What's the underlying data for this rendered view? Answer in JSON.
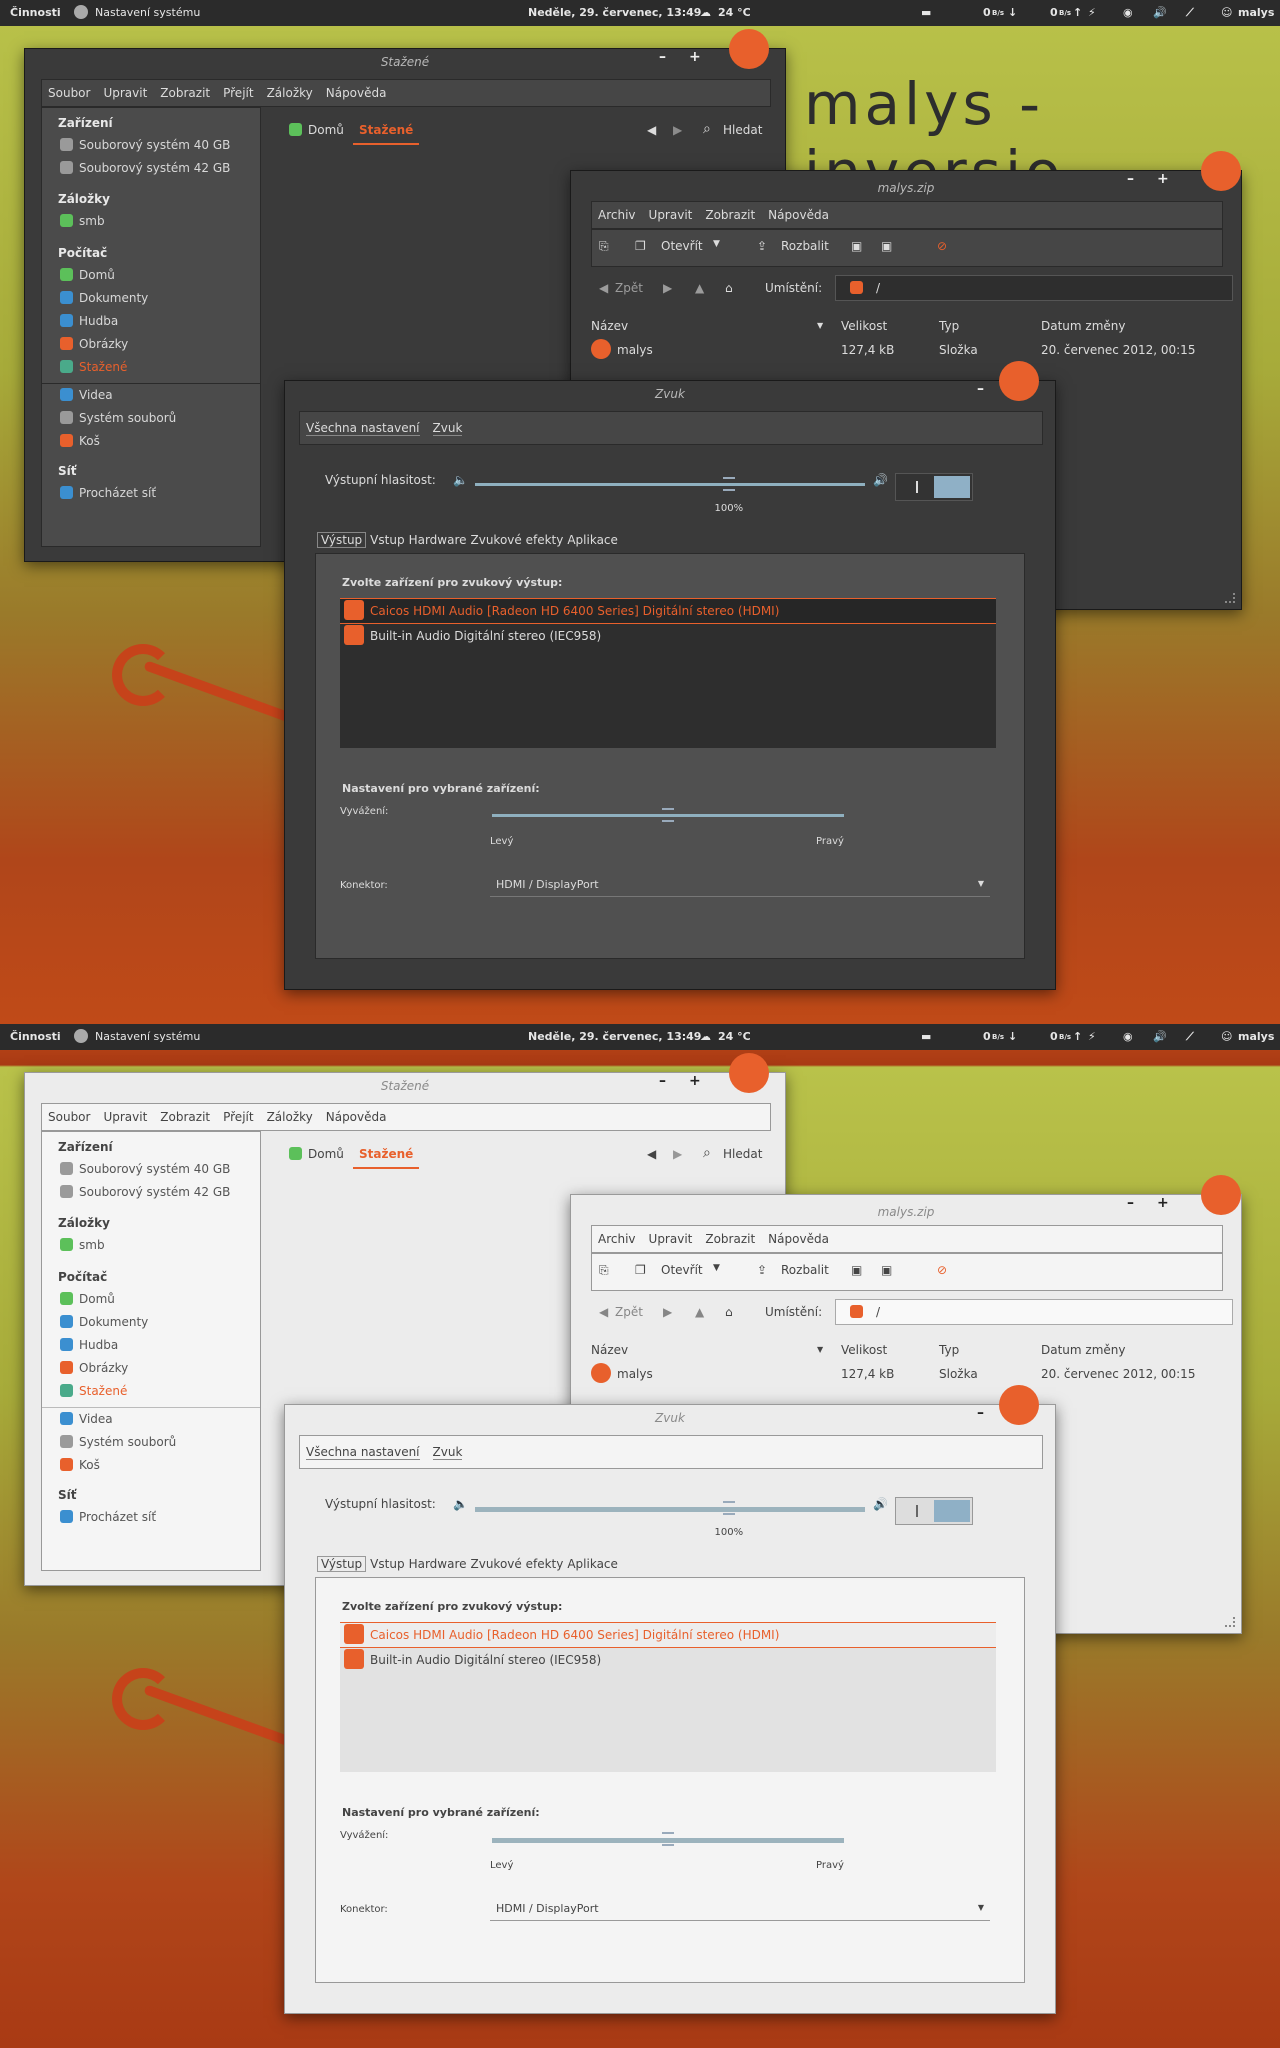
{
  "panel": {
    "activities": "Činnosti",
    "app": "Nastavení systému",
    "clock": "Neděle, 29. červenec, 13:49",
    "weather": "24 °C",
    "net_down": "0",
    "net_down_unit": "B/s",
    "net_up": "0",
    "net_up_unit": "B/s",
    "user": "malys"
  },
  "brand": "malys   -   inversio",
  "nautilus": {
    "title": "Stažené",
    "menu": [
      "Soubor",
      "Upravit",
      "Zobrazit",
      "Přejít",
      "Záložky",
      "Nápověda"
    ],
    "path": [
      "Domů",
      "Stažené"
    ],
    "search": "Hledat",
    "sections": {
      "devices": "Zařízení",
      "bookmarks": "Záložky",
      "computer": "Počítač",
      "network": "Síť"
    },
    "devices": [
      "Souborový systém 40 GB",
      "Souborový systém 42 GB"
    ],
    "bookmarks": [
      "smb"
    ],
    "computer": [
      "Domů",
      "Dokumenty",
      "Hudba",
      "Obrázky",
      "Stažené",
      "Videa",
      "Systém souborů",
      "Koš"
    ],
    "network": [
      "Procházet síť"
    ]
  },
  "archive": {
    "title": "malys.zip",
    "menu": [
      "Archiv",
      "Upravit",
      "Zobrazit",
      "Nápověda"
    ],
    "open": "Otevřít",
    "extract": "Rozbalit",
    "back": "Zpět",
    "location_label": "Umístění:",
    "location_value": "/",
    "columns": [
      "Název",
      "Velikost",
      "Typ",
      "Datum změny"
    ],
    "rows": [
      {
        "name": "malys",
        "size": "127,4 kB",
        "type": "Složka",
        "date": "20. červenec 2012, 00:15"
      }
    ]
  },
  "sound": {
    "title": "Zvuk",
    "breadcrumb": [
      "Všechna nastavení",
      "Zvuk"
    ],
    "volume_label": "Výstupní hlasitost:",
    "volume_value": "100%",
    "volume_level": 0.65,
    "tabs": [
      "Výstup",
      "Vstup",
      "Hardware",
      "Zvukové efekty",
      "Aplikace"
    ],
    "choose_label": "Zvolte zařízení pro zvukový výstup:",
    "devices": [
      "Caicos HDMI Audio [Radeon HD 6400 Series] Digitální stereo (HDMI)",
      "Built-in Audio Digitální stereo (IEC958)"
    ],
    "settings_label": "Nastavení pro vybrané zařízení:",
    "balance_label": "Vyvážení:",
    "balance_left": "Levý",
    "balance_right": "Pravý",
    "balance_level": 0.5,
    "connector_label": "Konektor:",
    "connector_value": "HDMI / DisplayPort"
  },
  "colors": {
    "accent": "#e8602c",
    "slider": "#8fb0bf",
    "dark_bg": "#3a3a3a",
    "light_bg": "#ececec"
  }
}
